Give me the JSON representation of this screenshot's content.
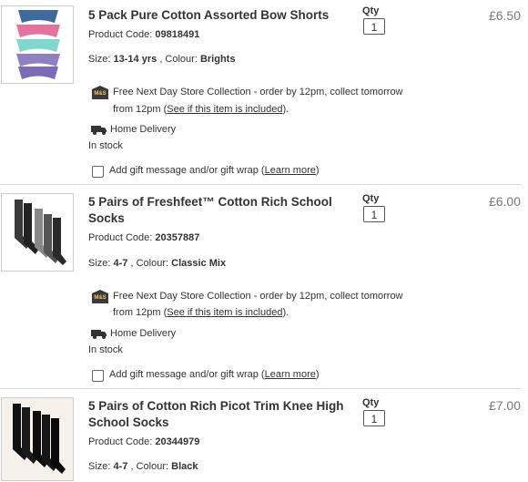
{
  "common": {
    "qty_label": "Qty",
    "product_code_label": "Product Code:",
    "size_label": "Size:",
    "colour_label": ", Colour:",
    "store_line1": "Free Next Day Store Collection - order by 12pm, collect tomorrow",
    "store_line2_pre": "from 12pm (",
    "store_link": "See if this item is included",
    "store_line2_post": ").",
    "home_delivery": "Home Delivery",
    "stock": "In stock",
    "gift_pre": "Add gift message and/or gift wrap (",
    "gift_link": "Learn more",
    "gift_post": ")",
    "ms_badge": "M&S"
  },
  "items": [
    {
      "title": "5 Pack Pure Cotton Assorted Bow Shorts",
      "code": "09818491",
      "size": "13-14 yrs",
      "colour": "Brights",
      "qty": "1",
      "price": "£6.50"
    },
    {
      "title": "5 Pairs of Freshfeet™ Cotton Rich School Socks",
      "code": "20357887",
      "size": "4-7",
      "colour": "Classic Mix",
      "qty": "1",
      "price": "£6.00"
    },
    {
      "title": "5 Pairs of Cotton Rich Picot Trim Knee High School Socks",
      "code": "20344979",
      "size": "4-7",
      "colour": "Black",
      "qty": "1",
      "price": "£7.00"
    }
  ]
}
